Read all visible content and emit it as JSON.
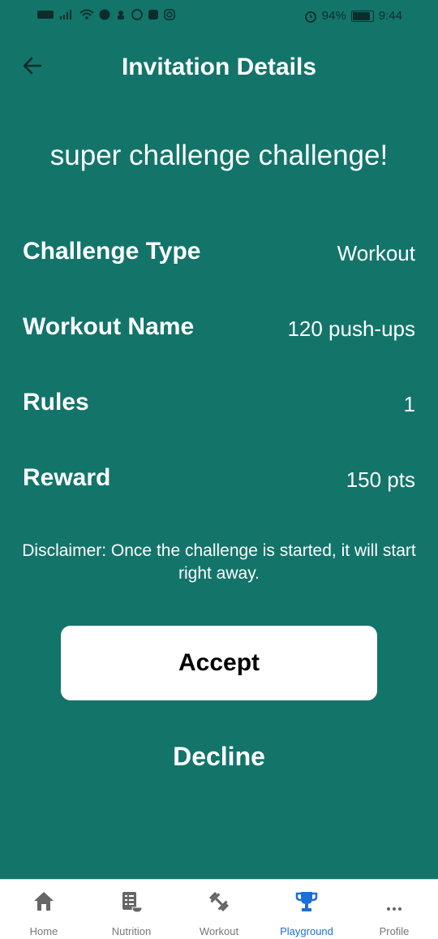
{
  "status": {
    "battery": "94%",
    "time": "9:44",
    "battery_level": 0.94
  },
  "header": {
    "title": "Invitation Details"
  },
  "challenge": {
    "name": "super challenge  challenge!"
  },
  "details": [
    {
      "label": "Challenge Type",
      "value": "Workout"
    },
    {
      "label": "Workout Name",
      "value": "120 push-ups"
    },
    {
      "label": "Rules",
      "value": "1"
    },
    {
      "label": "Reward",
      "value": "150 pts"
    }
  ],
  "disclaimer": "Disclaimer: Once the challenge is started, it will start right away.",
  "actions": {
    "accept": "Accept",
    "decline": "Decline"
  },
  "nav": {
    "items": [
      {
        "label": "Home",
        "icon": "home-icon"
      },
      {
        "label": "Nutrition",
        "icon": "nutrition-icon"
      },
      {
        "label": "Workout",
        "icon": "dumbbell-icon"
      },
      {
        "label": "Playground",
        "icon": "trophy-icon"
      },
      {
        "label": "Profile",
        "icon": "more-icon"
      }
    ],
    "active": "Playground",
    "active_color": "#1a6fd6",
    "inactive_color": "#777777"
  },
  "colors": {
    "background": "#13746a",
    "button_bg": "#ffffff"
  }
}
